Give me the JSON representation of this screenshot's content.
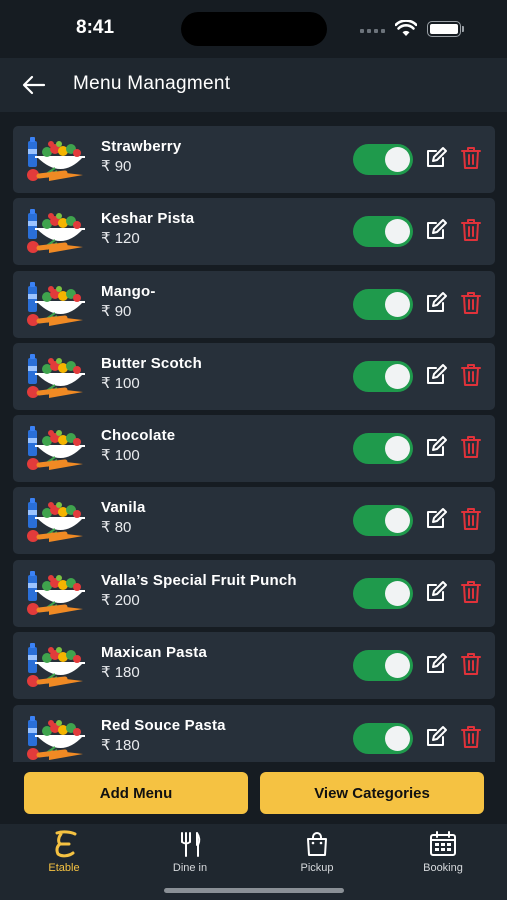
{
  "status_bar": {
    "time": "8:41"
  },
  "header": {
    "title": "Menu Managment"
  },
  "menu_items": [
    {
      "name": "Strawberry",
      "price": "₹ 90",
      "enabled": true
    },
    {
      "name": "Keshar Pista",
      "price": "₹ 120",
      "enabled": true
    },
    {
      "name": "Mango-",
      "price": "₹ 90",
      "enabled": true
    },
    {
      "name": "Butter Scotch",
      "price": "₹ 100",
      "enabled": true
    },
    {
      "name": "Chocolate",
      "price": "₹ 100",
      "enabled": true
    },
    {
      "name": "Vanila",
      "price": "₹ 80",
      "enabled": true
    },
    {
      "name": "Valla’s Special Fruit Punch",
      "price": "₹ 200",
      "enabled": true
    },
    {
      "name": "Maxican Pasta",
      "price": "₹ 180",
      "enabled": true
    },
    {
      "name": "Red Souce Pasta",
      "price": "₹ 180",
      "enabled": true
    }
  ],
  "actions": {
    "add_menu": "Add Menu",
    "view_categories": "View Categories"
  },
  "tabs": [
    {
      "label": "Etable",
      "icon": "etable-logo-icon",
      "active": true
    },
    {
      "label": "Dine in",
      "icon": "fork-knife-icon",
      "active": false
    },
    {
      "label": "Pickup",
      "icon": "shopping-bag-icon",
      "active": false
    },
    {
      "label": "Booking",
      "icon": "calendar-icon",
      "active": false
    }
  ],
  "colors": {
    "background": "#161c22",
    "card": "#27303a",
    "toggle_on": "#1f9a4c",
    "accent": "#f5c242",
    "delete": "#e0323a"
  }
}
